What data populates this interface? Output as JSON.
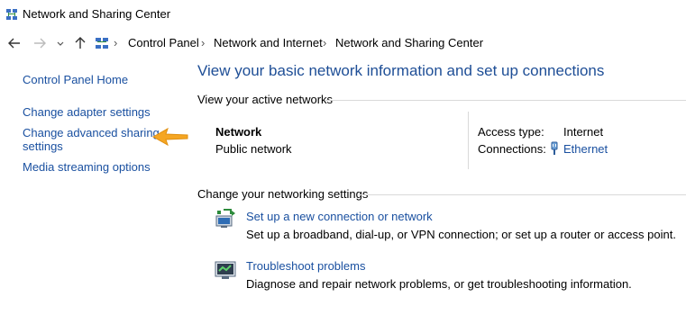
{
  "window": {
    "title": "Network and Sharing Center"
  },
  "address": {
    "crumbs": [
      "Control Panel",
      "Network and Internet",
      "Network and Sharing Center"
    ]
  },
  "sidebar": {
    "items": [
      {
        "label": "Control Panel Home"
      },
      {
        "label": "Change adapter settings"
      },
      {
        "label": "Change advanced sharing"
      },
      {
        "label": "settings"
      },
      {
        "label": "Media streaming options"
      }
    ]
  },
  "main": {
    "heading": "View your basic network information and set up connections",
    "active_networks_label": "View your active networks",
    "network": {
      "name": "Network",
      "type": "Public network",
      "access_type_label": "Access type:",
      "access_type_value": "Internet",
      "connections_label": "Connections:",
      "connections_value": "Ethernet"
    },
    "change_settings_label": "Change your networking settings",
    "tasks": [
      {
        "link": "Set up a new connection or network",
        "desc": "Set up a broadband, dial-up, or VPN connection; or set up a router or access point."
      },
      {
        "link": "Troubleshoot problems",
        "desc": "Diagnose and repair network problems, or get troubleshooting information."
      }
    ]
  },
  "colors": {
    "link": "#1a50a0",
    "heading": "#1e4e96",
    "pointer": "#f5a623"
  }
}
